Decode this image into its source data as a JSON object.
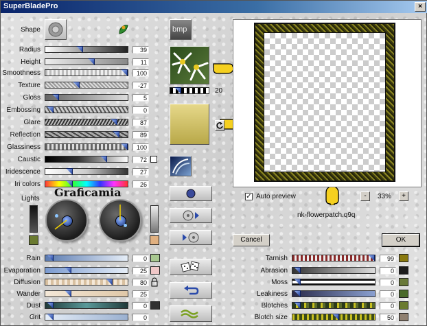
{
  "title": "SuperBladePro",
  "shape_label": "Shape",
  "bmp_label": "bmp",
  "params_left": [
    {
      "label": "Radius",
      "value": "39"
    },
    {
      "label": "Height",
      "value": "11"
    },
    {
      "label": "Smoothness",
      "value": "100"
    },
    {
      "label": "Texture",
      "value": "-27"
    },
    {
      "label": "Gloss",
      "value": "5"
    },
    {
      "label": "Embossing",
      "value": "0"
    },
    {
      "label": "Glare",
      "value": "87"
    },
    {
      "label": "Reflection",
      "value": "89"
    },
    {
      "label": "Glassiness",
      "value": "100"
    },
    {
      "label": "Caustic",
      "value": "72"
    },
    {
      "label": "Iridescence",
      "value": "27"
    },
    {
      "label": "Iri colors",
      "value": "26"
    }
  ],
  "texture_scale_value": "20",
  "lights_label": "Lights",
  "watermark": "Graficamia",
  "params_bottom_left": [
    {
      "label": "Rain",
      "value": "0"
    },
    {
      "label": "Evaporation",
      "value": "25"
    },
    {
      "label": "Diffusion",
      "value": "80"
    },
    {
      "label": "Wander",
      "value": "25"
    },
    {
      "label": "Dust",
      "value": "0"
    },
    {
      "label": "Grit",
      "value": "0"
    }
  ],
  "params_right": [
    {
      "label": "Tarnish",
      "value": "99"
    },
    {
      "label": "Abrasion",
      "value": "0"
    },
    {
      "label": "Moss",
      "value": "0"
    },
    {
      "label": "Leakiness",
      "value": "0"
    },
    {
      "label": "Blotches",
      "value": "0"
    },
    {
      "label": "Blotch size",
      "value": "50"
    }
  ],
  "auto_preview_label": "Auto preview",
  "zoom_minus": "-",
  "zoom_value": "33%",
  "zoom_plus": "+",
  "preset_name": "nk-flowerpatch.q9q",
  "cancel_label": "Cancel",
  "ok_label": "OK",
  "colors": {
    "titlebar": "#0a246a",
    "gold_swatch": "#c8b85a",
    "rain_swatch": "#a8c890",
    "evaporation_swatch": "#f0c8c8",
    "dust_swatch": "#303030",
    "tarnish_swatch": "#8a7a10",
    "abrasion_swatch": "#1c1c1c",
    "moss_swatch": "#6a7a3a",
    "leakiness_swatch": "#4a6a2a",
    "blotches_swatch": "#6a7a30",
    "blotch_size_swatch": "#908070"
  },
  "icons": {
    "shape": "bevel-shape-icon",
    "leaf": "leaf-icon",
    "pointer": "hand-pointer-icon",
    "sphere": "sphere-icon",
    "cd_forward": "cd-forward-icon",
    "cd_back": "cd-back-icon",
    "dice": "dice-icon",
    "undo": "undo-icon",
    "wave": "wave-icon",
    "refresh": "refresh-icon",
    "lock": "lock-icon"
  }
}
